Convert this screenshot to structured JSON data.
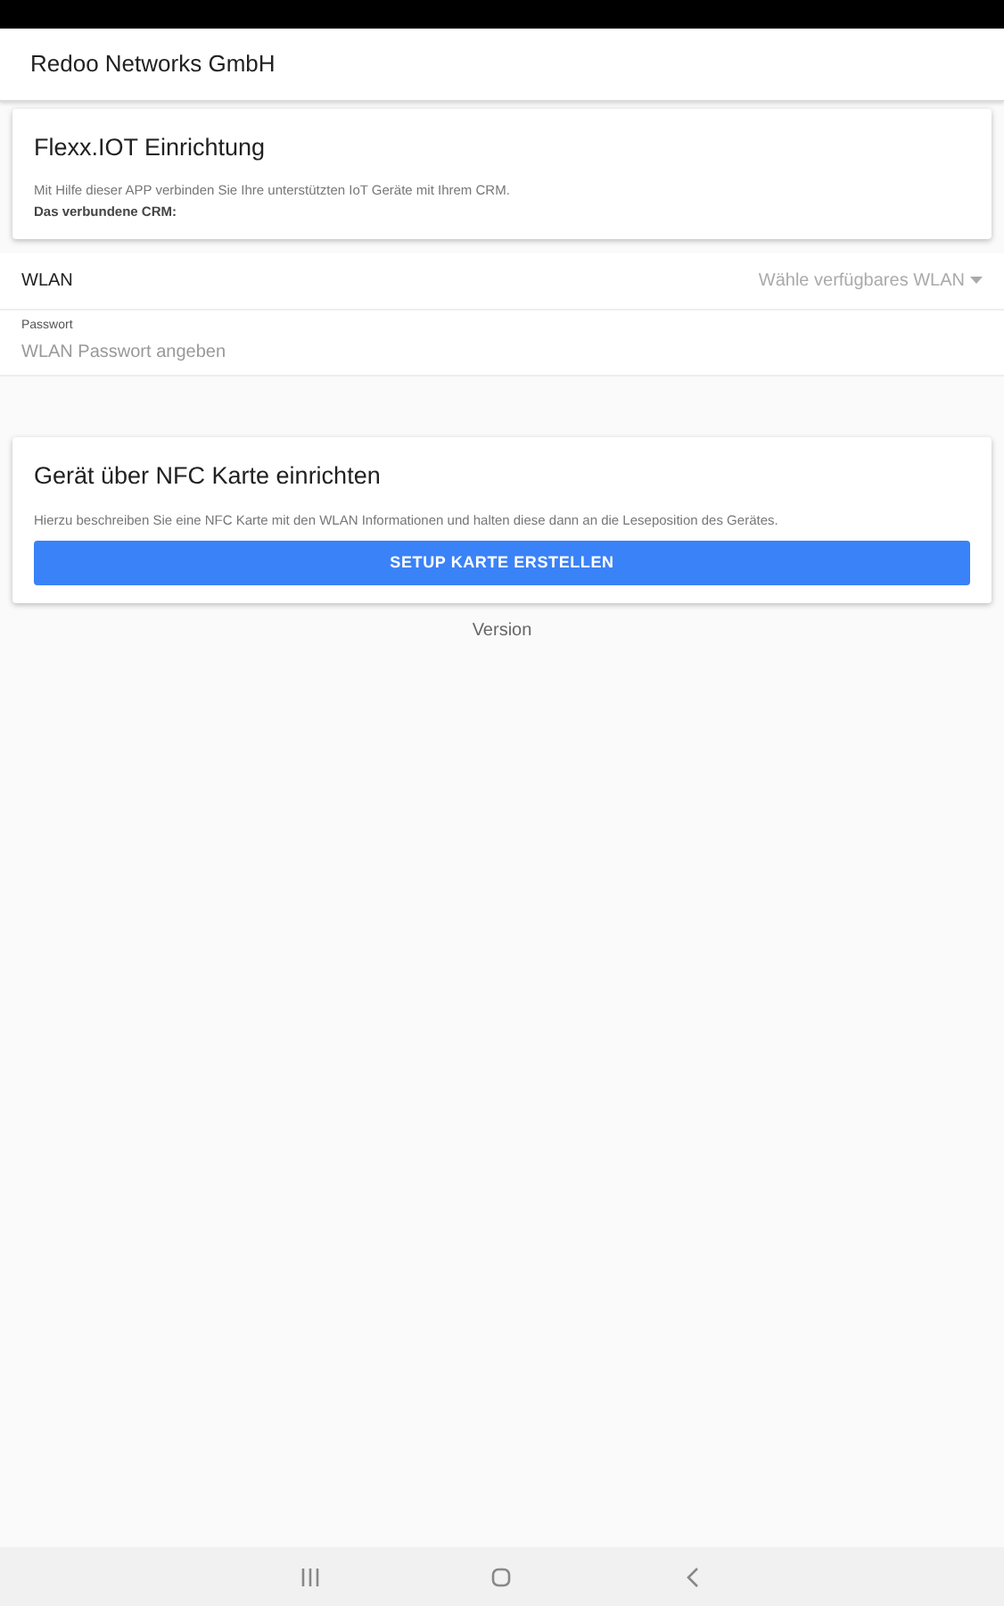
{
  "app_bar": {
    "title": "Redoo Networks GmbH"
  },
  "setup_card": {
    "title": "Flexx.IOT Einrichtung",
    "description": "Mit Hilfe dieser APP verbinden Sie Ihre unterstützten IoT Geräte mit Ihrem CRM.",
    "crm_label": "Das verbundene CRM:"
  },
  "wlan": {
    "label": "WLAN",
    "placeholder": "Wähle verfügbares WLAN"
  },
  "password": {
    "label": "Passwort",
    "placeholder": "WLAN Passwort angeben"
  },
  "nfc_card": {
    "title": "Gerät über NFC Karte einrichten",
    "description": "Hierzu beschreiben Sie eine NFC Karte mit den WLAN Informationen und halten diese dann an die Leseposition des Gerätes.",
    "button": "SETUP KARTE ERSTELLEN"
  },
  "version": "Version",
  "nav_bar": [
    {
      "kind": "recents"
    },
    {
      "kind": "home"
    },
    {
      "kind": "back"
    }
  ]
}
